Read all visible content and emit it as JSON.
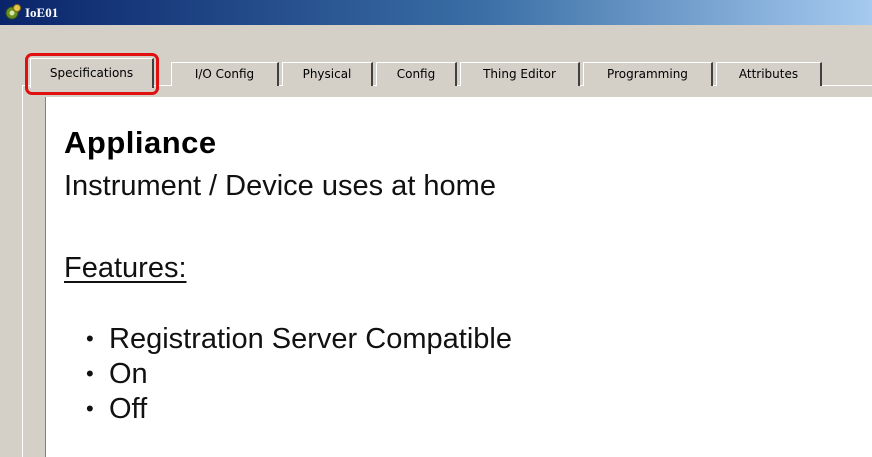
{
  "window": {
    "title": "IoE01",
    "icon": "device-gear-icon"
  },
  "tabs": [
    {
      "label": "Specifications",
      "active": true
    },
    {
      "label": "I/O Config",
      "active": false
    },
    {
      "label": "Physical",
      "active": false
    },
    {
      "label": "Config",
      "active": false
    },
    {
      "label": "Thing Editor",
      "active": false
    },
    {
      "label": "Programming",
      "active": false
    },
    {
      "label": "Attributes",
      "active": false
    }
  ],
  "specifications": {
    "heading": "Appliance",
    "subtitle": "Instrument / Device uses at home",
    "features_label": "Features:",
    "features": [
      "Registration Server Compatible",
      "On",
      "Off"
    ]
  },
  "colors": {
    "highlight": "#e01010",
    "titlebar_start": "#0a246a",
    "titlebar_end": "#a6caf0"
  }
}
